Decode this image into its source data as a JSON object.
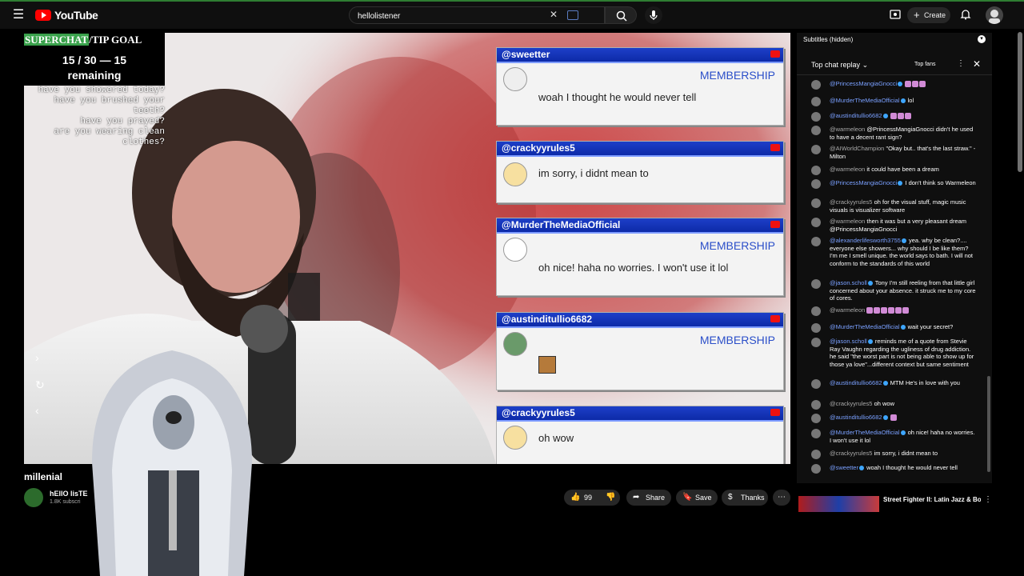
{
  "topbar": {
    "logo_text": "YouTube",
    "search_value": "hellolistener",
    "search_clear": "✕",
    "create_label": "Create",
    "icons": [
      "menu-icon",
      "youtube-logo-icon",
      "keyboard-icon",
      "search-icon",
      "mic-icon",
      "cast-icon",
      "bell-icon"
    ]
  },
  "video": {
    "goal_title_a": "SUPERCHAT",
    "goal_title_b": "/TIP GOAL",
    "goal_count": "15 / 30 — 15",
    "goal_remaining": "remaining",
    "prompts": [
      "have you showered today?",
      "have you brushed your teeth?",
      "have you prayed?",
      "are you wearing clean clothes?"
    ],
    "cards": [
      {
        "name": "@sweetter",
        "membership": "MEMBERSHIP",
        "message": "woah I thought he would never tell"
      },
      {
        "name": "@crackyyrules5",
        "membership": "",
        "message": "im sorry, i didnt mean to"
      },
      {
        "name": "@MurderTheMediaOfficial",
        "membership": "MEMBERSHIP",
        "message": "oh nice! haha no worries. I won't use it lol"
      },
      {
        "name": "@austinditullio6682",
        "membership": "MEMBERSHIP",
        "message": ""
      },
      {
        "name": "@crackyyrules5",
        "membership": "",
        "message": "oh wow"
      }
    ]
  },
  "below": {
    "title": "millenial",
    "channel_name": "hEllO lisTE",
    "channel_subs": "1.8K subscri",
    "like_count": "99",
    "share": "Share",
    "save": "Save",
    "thanks": "Thanks"
  },
  "chat": {
    "subtitles": "Subtitles (hidden)",
    "mode": "Top chat replay",
    "top_fans": "Top fans",
    "messages": [
      {
        "author": "@PrincessMangiaGnocci",
        "text": "",
        "emotes": 3,
        "style": "blue"
      },
      {
        "author": "@MurderTheMediaOfficial",
        "text": "lol",
        "emotes": 0,
        "style": "blue"
      },
      {
        "author": "@austinditullio6682",
        "text": "",
        "emotes": 3,
        "style": "blue"
      },
      {
        "author": "@warmeleon",
        "text": "@PrincessMangiaGnocci didn't he used to have a decent rant sign?",
        "emotes": 0,
        "style": "gray"
      },
      {
        "author": "@AIWorldChampion",
        "text": "\"Okay but.. that's the last straw.\" - Milton",
        "emotes": 0,
        "style": "gray"
      },
      {
        "author": "@warmeleon",
        "text": "it could have been a dream",
        "emotes": 0,
        "style": "gray"
      },
      {
        "author": "@PrincessMangiaGnocci",
        "text": "I don't think so Warmeleon",
        "emotes": 0,
        "style": "blue"
      },
      {
        "author": "@crackyyrules5",
        "text": "oh for the visual stuff, magic music visuals is visualizer software",
        "emotes": 0,
        "style": "gray"
      },
      {
        "author": "@warmeleon",
        "text": "then it was but a very pleasant dream @PrincessMangiaGnocci",
        "emotes": 0,
        "style": "gray"
      },
      {
        "author": "@alexanderlifesworth3755",
        "text": "yea. why be clean?.... everyone else showers... why should I be like them? I'm me I smell unique. the world says to bath. I will not conform to the standards of this world",
        "emotes": 0,
        "style": "blue"
      },
      {
        "author": "@jason.scholl",
        "text": "Tony I'm still reeling from that little girl concerned about your absence. it struck me to my core of cores.",
        "emotes": 0,
        "style": "green"
      },
      {
        "author": "@warmeleon",
        "text": "",
        "emotes": 6,
        "style": "gray"
      },
      {
        "author": "@MurderTheMediaOfficial",
        "text": "wait your secret?",
        "emotes": 0,
        "style": "blue"
      },
      {
        "author": "@jason.scholl",
        "text": "reminds me of a quote from Stevie Ray Vaughn regarding the ugliness of drug addiction. he said \"the worst part is not being able to show up for those ya love\"...different context but same sentiment",
        "emotes": 0,
        "style": "green"
      },
      {
        "author": "@austinditullio6682",
        "text": "MTM He's in love with you",
        "emotes": 0,
        "style": "blue"
      },
      {
        "author": "@crackyyrules5",
        "text": "oh wow",
        "emotes": 0,
        "style": "gray"
      },
      {
        "author": "@austinditullio6682",
        "text": "",
        "emotes": 1,
        "style": "blue"
      },
      {
        "author": "@MurderTheMediaOfficial",
        "text": "oh nice! haha no worries. I won't use it lol",
        "emotes": 0,
        "style": "blue"
      },
      {
        "author": "@crackyyrules5",
        "text": "im sorry, i didnt mean to",
        "emotes": 0,
        "style": "gray"
      },
      {
        "author": "@sweetter",
        "text": "woah I thought he would never tell",
        "emotes": 0,
        "style": "blue"
      }
    ]
  },
  "recommended": {
    "title": "Street Fighter II: Latin Jazz & Bolero Covers (Full Album) |"
  },
  "colors": {
    "accent_red": "#ff0000",
    "goal_green": "#3aa24c",
    "card_blue": "#1d3fc8",
    "membership_blue": "#2b4fc9",
    "chat_author_blue": "#7aa0ff"
  }
}
